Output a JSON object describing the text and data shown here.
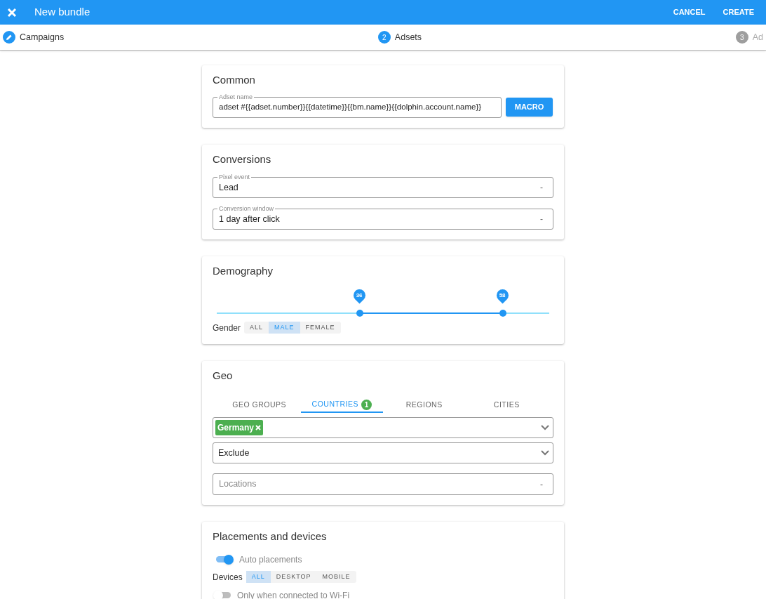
{
  "app_bar": {
    "title": "New bundle",
    "actions": [
      "CANCEL",
      "CREATE"
    ]
  },
  "steps": [
    {
      "label": "Campaigns",
      "kind": "done"
    },
    {
      "label": "Adsets",
      "kind": "active",
      "number": "2"
    },
    {
      "label": "Ad",
      "kind": "todo",
      "number": "3"
    }
  ],
  "common": {
    "title": "Common",
    "adset_name": {
      "label": "Adset name",
      "value": "adset #{{adset.number}}{{datetime}}{{bm.name}}{{dolphin.account.name}}"
    },
    "macro_button": "MACRO"
  },
  "conversions": {
    "title": "Conversions",
    "fields": [
      {
        "label": "Pixel event",
        "value": "Lead",
        "suffix": "-"
      },
      {
        "label": "Conversion window",
        "value": "1 day after click",
        "suffix": "-"
      }
    ]
  },
  "demography": {
    "title": "Demography",
    "age_slider": {
      "thumbs": [
        {
          "label": "36",
          "level": 0.43
        },
        {
          "label": "58",
          "level": 0.86
        }
      ]
    },
    "gender": {
      "label": "Gender",
      "options": [
        {
          "label": "ALL",
          "selected": false
        },
        {
          "label": "MALE",
          "selected": true
        },
        {
          "label": "FEMALE",
          "selected": false
        }
      ]
    }
  },
  "geo": {
    "title": "Geo",
    "tabs": [
      {
        "label": "GEO GROUPS",
        "selected": false
      },
      {
        "label": "COUNTRIES",
        "selected": true,
        "badge": "1"
      },
      {
        "label": "REGIONS",
        "selected": false
      },
      {
        "label": "CITIES",
        "selected": false
      }
    ],
    "countries": [
      "Germany"
    ],
    "mode": "Exclude",
    "locations": {
      "placeholder": "Locations",
      "suffix": "-"
    }
  },
  "placements": {
    "title": "Placements and devices",
    "auto_placements": {
      "label": "Auto placements",
      "on": true
    },
    "devices": {
      "label": "Devices",
      "options": [
        {
          "label": "ALL",
          "selected": true
        },
        {
          "label": "DESKTOP",
          "selected": false
        },
        {
          "label": "MOBILE",
          "selected": false
        }
      ]
    },
    "wifi_only": {
      "label": "Only when connected to Wi-Fi",
      "on": false
    }
  }
}
